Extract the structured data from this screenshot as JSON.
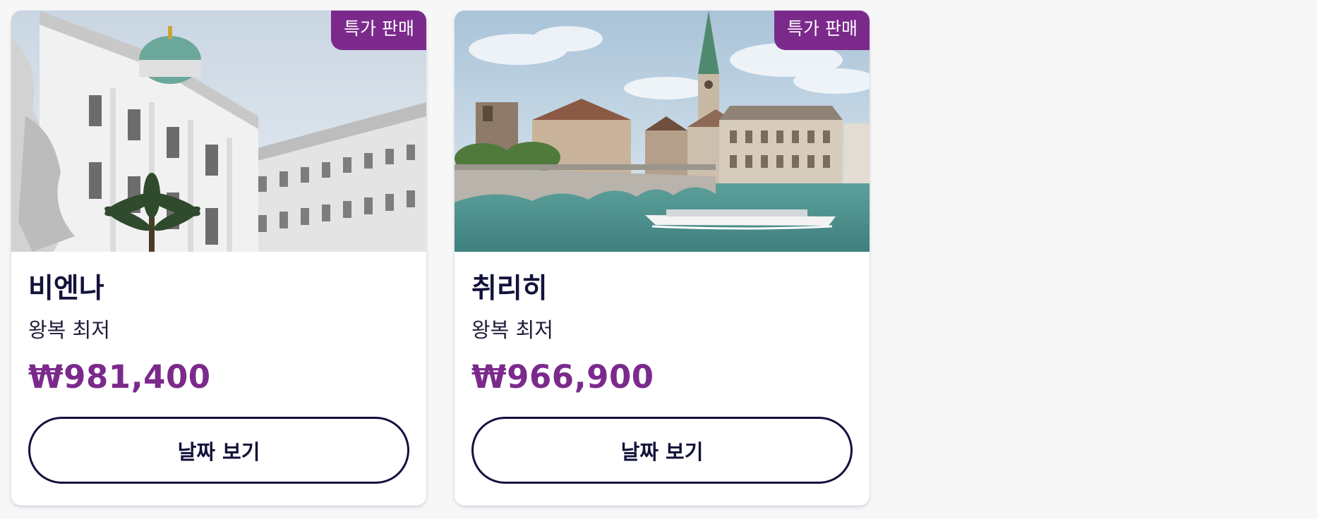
{
  "cards": [
    {
      "badge": "특가 판매",
      "city": "비엔나",
      "tagline": "왕복 최저",
      "price": "₩981,400",
      "button_label": "날짜 보기"
    },
    {
      "badge": "특가 판매",
      "city": "취리히",
      "tagline": "왕복 최저",
      "price": "₩966,900",
      "button_label": "날짜 보기"
    }
  ],
  "colors": {
    "accent": "#7b2a8c",
    "text_dark": "#12123a",
    "button_border": "#14103f",
    "background": "#f7f7f8"
  }
}
